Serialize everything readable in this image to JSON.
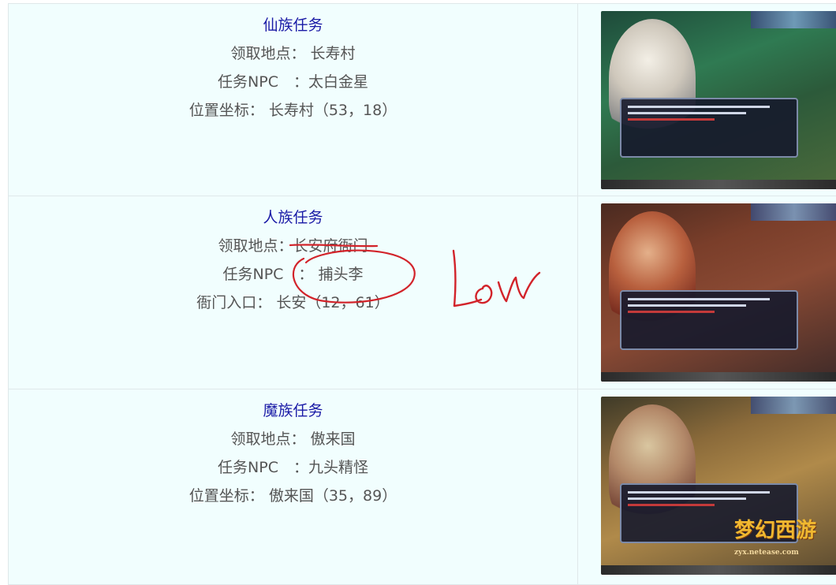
{
  "rows": [
    {
      "title": "仙族任务",
      "lines": [
        "领取地点： 长寿村",
        "任务NPC　：太白金星",
        "位置坐标： 长寿村（53，18）"
      ]
    },
    {
      "title": "人族任务",
      "lines": [
        "领取地点：长安府衙门",
        "任务NPC　： 捕头李",
        "衙门入口： 长安（12，61）"
      ]
    },
    {
      "title": "魔族任务",
      "lines": [
        "领取地点： 傲来国",
        "任务NPC　：九头精怪",
        "位置坐标： 傲来国（35，89）"
      ]
    }
  ],
  "annotation": {
    "handwritten_text": "Low",
    "color": "#d2232a"
  },
  "watermark": {
    "text": "梦幻西游",
    "sub": "zyx.netease.com"
  },
  "colors": {
    "cell_bg": "#f1fefe",
    "title_text": "#1a1aa6",
    "body_text": "#555555",
    "border": "#dfe8ea"
  },
  "icons": {
    "screenshots": [
      "npc-taibai-screenshot",
      "npc-butouli-screenshot",
      "npc-jiutou-screenshot"
    ]
  }
}
